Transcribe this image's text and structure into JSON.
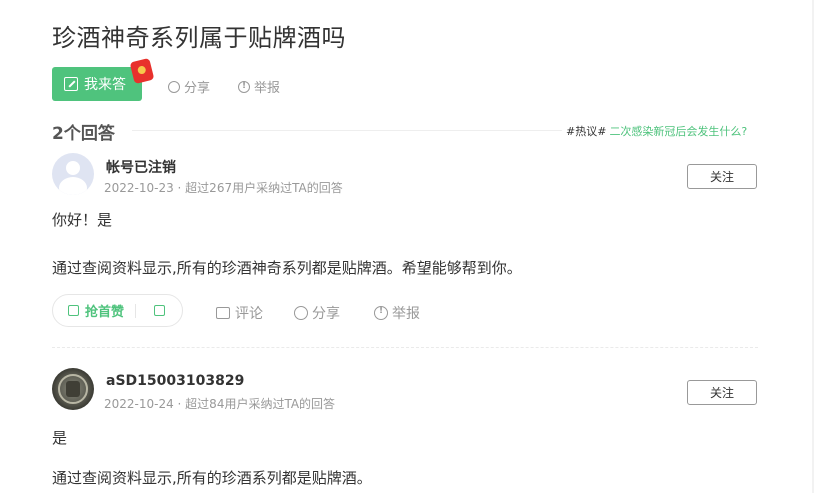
{
  "question": {
    "title": "珍酒神奇系列属于贴牌酒吗",
    "answer_button": "我来答",
    "share": "分享",
    "report": "举报"
  },
  "answers_header": {
    "count": "2个回答",
    "hot_tag": "#热议#",
    "hot_link": "二次感染新冠后会发生什么?"
  },
  "answers": [
    {
      "username": "帐号已注销",
      "meta": "2022-10-23 · 超过267用户采纳过TA的回答",
      "follow": "关注",
      "line1": "你好！是",
      "line2": "通过查阅资料显示,所有的珍酒神奇系列都是贴牌酒。希望能够帮到你。",
      "upvote": "抢首赞",
      "comment": "评论",
      "share": "分享",
      "report": "举报"
    },
    {
      "username": "aSD15003103829",
      "meta": "2022-10-24 · 超过84用户采纳过TA的回答",
      "follow": "关注",
      "line1": "是",
      "line2": "通过查阅资料显示,所有的珍酒系列都是贴牌酒。"
    }
  ],
  "colors": {
    "accent_green": "#4fc37d",
    "redpacket": "#e8312c"
  },
  "icons": [
    "edit-icon",
    "redpacket-icon",
    "share-icon",
    "report-icon",
    "default-avatar",
    "coin-avatar",
    "thumb-up-icon",
    "thumb-down-icon",
    "comment-icon"
  ]
}
